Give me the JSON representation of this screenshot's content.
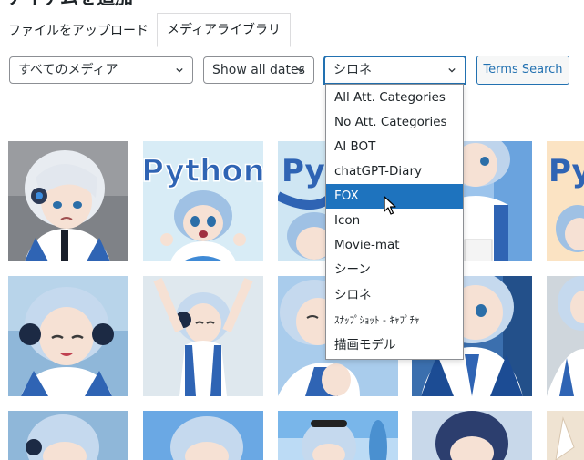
{
  "page_title": "アイテムを追加",
  "tabs": {
    "upload": "ファイルをアップロード",
    "library": "メディアライブラリ"
  },
  "filters": {
    "media_type": "すべてのメディア",
    "dates": "Show all dates",
    "terms": "シロネ",
    "terms_button": "Terms Search"
  },
  "dropdown": {
    "options": [
      "All Att. Categories",
      "No Att. Categories",
      "AI BOT",
      "chatGPT-Diary",
      "FOX",
      "Icon",
      "Movie-mat",
      "シーン",
      "シロネ",
      "ｽﾅｯﾌﾟｼｮｯﾄ - ｷｬﾌﾟﾁｬ",
      "描画モデル"
    ],
    "highlighted": "FOX"
  },
  "thumbnails": {
    "python_text": "Python",
    "python_partial": "Pyt"
  },
  "colors": {
    "accent": "#2271b1",
    "highlight": "#1e73be",
    "hair": "#c7d9ee",
    "suit": "#2f64b4"
  }
}
